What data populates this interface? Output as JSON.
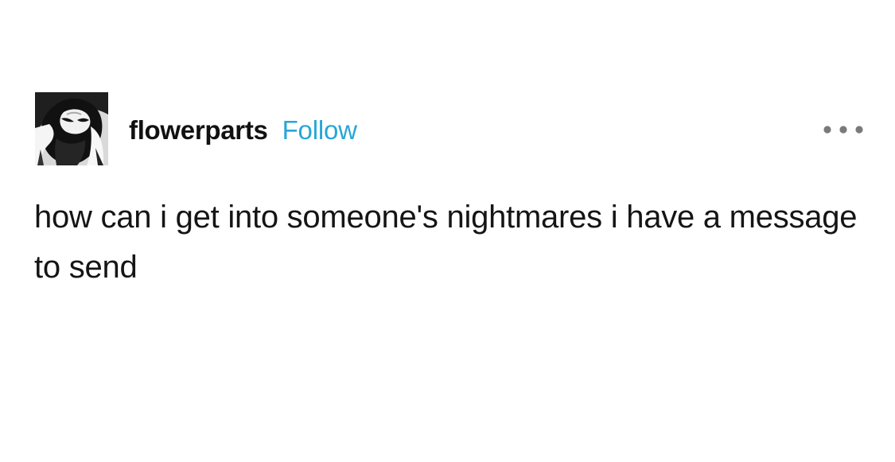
{
  "post": {
    "author": {
      "username": "flowerparts",
      "avatar_icon": "profile-photo"
    },
    "follow_label": "Follow",
    "more_icon": "more-options-icon",
    "body": "how can i get into someone's nightmares i have a message to send"
  },
  "colors": {
    "background": "#ffffff",
    "text": "#151515",
    "follow": "#27a6d7",
    "muted": "#7a7a7a"
  }
}
